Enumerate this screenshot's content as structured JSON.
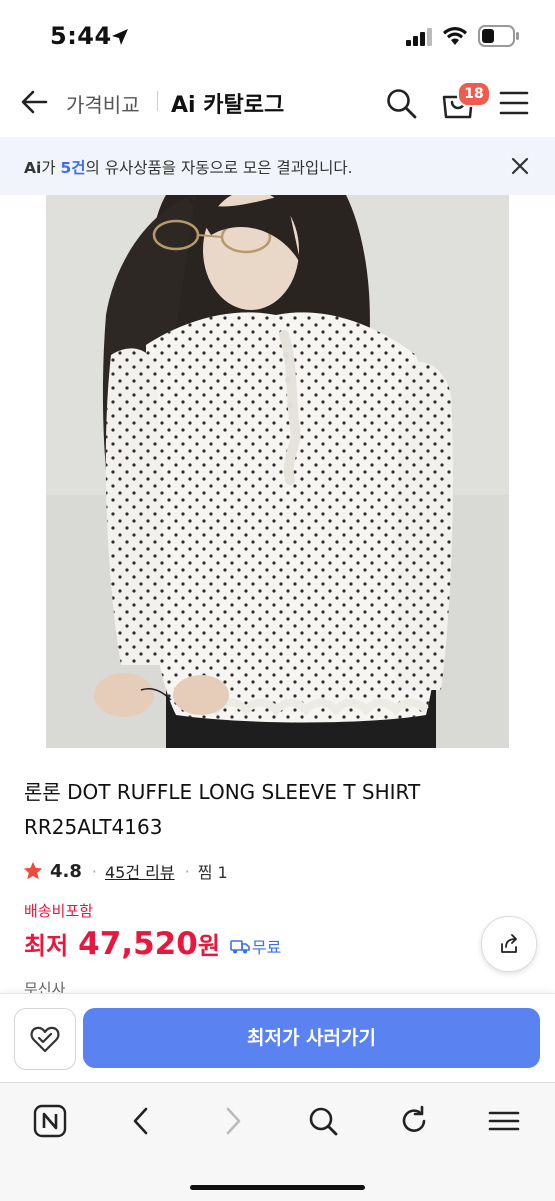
{
  "status_bar": {
    "time": "5:44"
  },
  "header": {
    "tab_compare": "가격비교",
    "tab_ai": "Ai 카탈로그",
    "cart_count": "18"
  },
  "banner": {
    "prefix": "Ai",
    "particle": "가 ",
    "count": "5건",
    "suffix": "의 유사상품을 자동으로 모은 결과입니다."
  },
  "product": {
    "title": "론론 DOT RUFFLE LONG SLEEVE T SHIRT RR25ALT4163",
    "rating": "4.8",
    "reviews": "45건 리뷰",
    "wishlist": "찜 1",
    "shipping_included": "배송비포함",
    "price_label": "최저",
    "price": "47,520",
    "price_unit": "원",
    "free_shipping": "무료",
    "seller": "무신사"
  },
  "bottom": {
    "buy_label": "최저가 사러가기"
  },
  "colors": {
    "accent_blue": "#5a82f0",
    "price_red": "#e8173d",
    "badge_red": "#f05a4f"
  },
  "icons": [
    "back-arrow-icon",
    "search-icon",
    "cart-icon",
    "menu-icon",
    "close-icon",
    "star-icon",
    "truck-icon",
    "share-icon",
    "heart-check-icon",
    "naver-home-icon",
    "browser-back-icon",
    "browser-forward-icon",
    "browser-search-icon",
    "refresh-icon",
    "browser-menu-icon"
  ]
}
